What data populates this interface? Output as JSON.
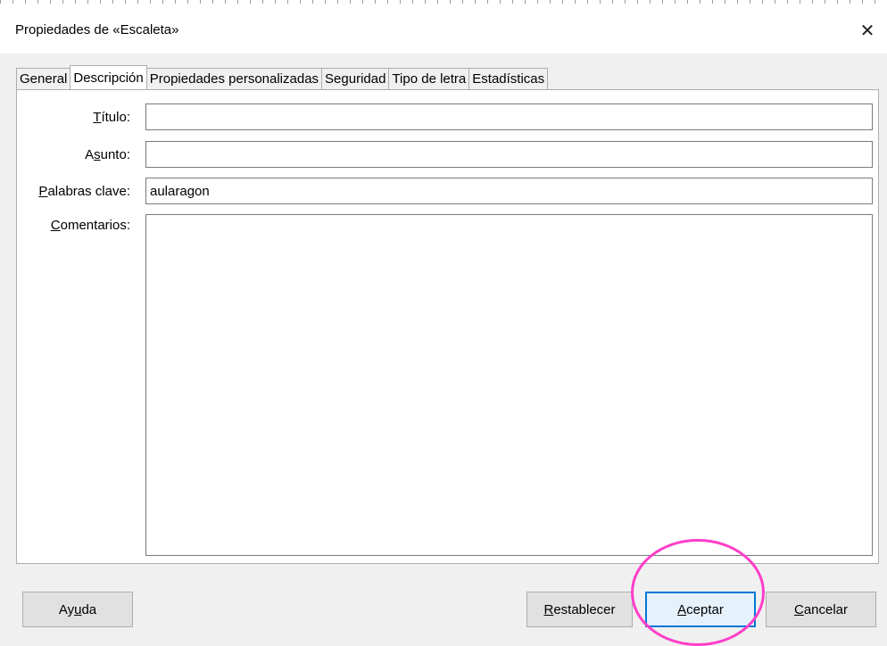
{
  "dialog": {
    "title": "Propiedades de «Escaleta»",
    "close_glyph": "✕"
  },
  "tabs": [
    {
      "label": "General"
    },
    {
      "label": "Descripción"
    },
    {
      "label": "Propiedades personalizadas"
    },
    {
      "label": "Seguridad"
    },
    {
      "label": "Tipo de letra"
    },
    {
      "label": "Estadísticas"
    }
  ],
  "active_tab": "Descripción",
  "fields": {
    "titulo": {
      "label_ul": "T",
      "label_rest": "ítulo:",
      "value": ""
    },
    "asunto": {
      "label_pre": "A",
      "label_ul": "s",
      "label_rest": "unto:",
      "value": ""
    },
    "palabras": {
      "label_ul": "P",
      "label_rest": "alabras clave:",
      "value": "aularagon"
    },
    "comentarios": {
      "label_ul": "C",
      "label_rest": "omentarios:",
      "value": ""
    }
  },
  "buttons": {
    "ayuda": {
      "pre": "Ay",
      "ul": "u",
      "post": "da"
    },
    "restablecer": {
      "pre": "",
      "ul": "R",
      "post": "establecer"
    },
    "aceptar": {
      "pre": "",
      "ul": "A",
      "post": "ceptar"
    },
    "cancelar": {
      "pre": "",
      "ul": "C",
      "post": "ancelar"
    }
  },
  "colors": {
    "highlight_circle": "#ff3ec8",
    "default_button_border": "#0078d7"
  }
}
